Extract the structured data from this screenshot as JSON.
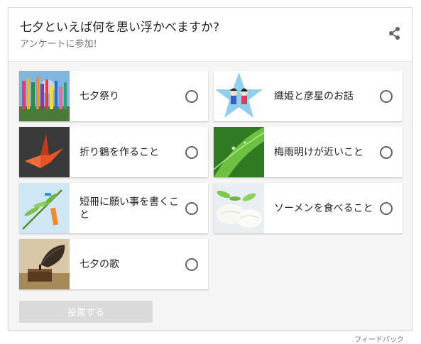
{
  "header": {
    "title": "七夕といえば何を思い浮かべますか?",
    "subtitle": "アンケートに参加!",
    "share_icon": "share-icon"
  },
  "options": [
    {
      "label": "七夕祭り",
      "selected": false
    },
    {
      "label": "織姫と彦星のお話",
      "selected": false
    },
    {
      "label": "折り鶴を作ること",
      "selected": false
    },
    {
      "label": "梅雨明けが近いこと",
      "selected": false
    },
    {
      "label": "短冊に願い事を書くこと",
      "selected": false
    },
    {
      "label": "ソーメンを食べること",
      "selected": false
    },
    {
      "label": "七夕の歌",
      "selected": false
    }
  ],
  "vote_button": {
    "label": "投票する",
    "enabled": false
  },
  "feedback_link": "フィードバック",
  "colors": {
    "card_border": "#dadce0",
    "body_background": "#f5f5f5",
    "vote_button_disabled": "#dadada",
    "radio_border": "#5f6368"
  }
}
